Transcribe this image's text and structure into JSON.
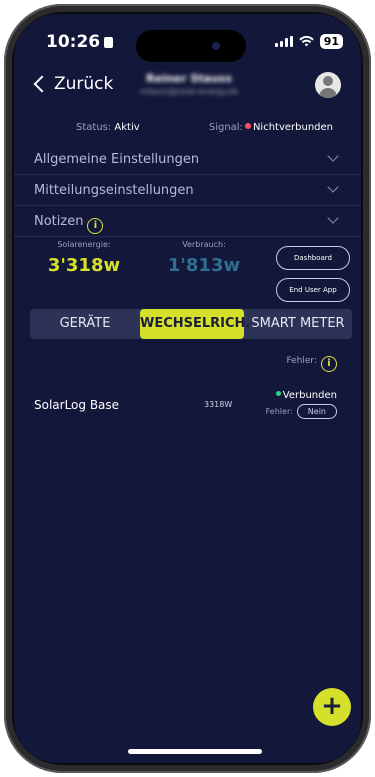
{
  "statusbar": {
    "time": "10:26",
    "battery": "91"
  },
  "nav": {
    "back_label": "Zurück",
    "user_name": "Reiner Stauss",
    "user_email": "rstauss@solar-energy.de"
  },
  "status": {
    "status_label": "Status:",
    "status_value": "Aktiv",
    "signal_label": "Signal:",
    "signal_value": "Nichtverbunden"
  },
  "sections": {
    "general": "Allgemeine Einstellungen",
    "messages": "Mitteilungseinstellungen",
    "notes": "Notizen"
  },
  "energy": {
    "solar_label": "Solarenergie:",
    "solar_value": "3'318w",
    "consumption_label": "Verbrauch:",
    "consumption_value": "1'813w",
    "dashboard_button": "Dashboard",
    "end_user_app_button": "End User App"
  },
  "tabs": {
    "devices": "GERÄTE",
    "inverter": "WECHSELRICH...",
    "smart_meter": "SMART METER"
  },
  "device_list": {
    "fehler_label": "Fehler:",
    "row": {
      "name": "SolarLog Base",
      "power": "3318W",
      "connection": "Verbunden",
      "error_label": "Fehler:",
      "error_value": "Nein"
    }
  },
  "fab": {
    "label": "+"
  },
  "colors": {
    "background": "#13173a",
    "accent": "#d4e02a",
    "consumption": "#2e6e8e",
    "connected": "#2ed47a",
    "disconnected": "#ff4d5e"
  }
}
